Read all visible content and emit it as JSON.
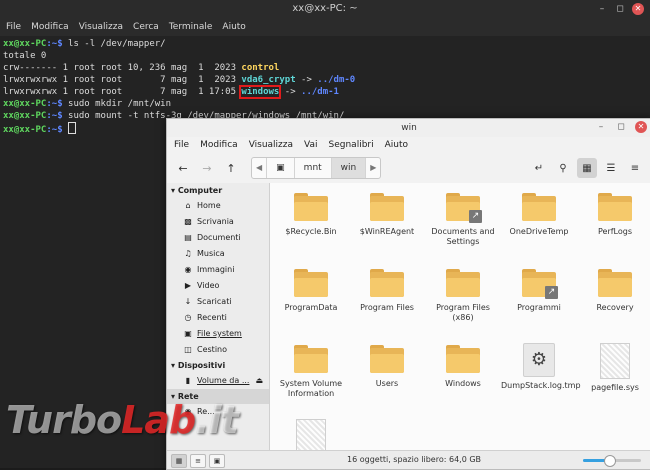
{
  "terminal": {
    "title": "xx@xx-PC: ~",
    "menu": [
      "File",
      "Modifica",
      "Visualizza",
      "Cerca",
      "Terminale",
      "Aiuto"
    ],
    "prompt_user": "xx@xx-PC",
    "prompt_path": ":~$",
    "cmd1": " ls -l /dev/mapper/",
    "out_total": "totale 0",
    "row1_perm": "crw------- 1 root root 10, 236 mag  1  2023 ",
    "row1_name": "control",
    "row2_perm": "lrwxrwxrwx 1 root root       7 mag  1  2023 ",
    "row2_name": "vda6_crypt",
    "row2_arrow": " -> ",
    "row2_target": "../dm-0",
    "row3_perm": "lrwxrwxrwx 1 root root       7 mag  1 17:05 ",
    "row3_name": "windows",
    "row3_arrow": " -> ",
    "row3_target": "../dm-1",
    "cmd2": " sudo mkdir /mnt/win",
    "cmd3": " sudo mount -t ntfs-3g /dev/mapper/windows /mnt/win/"
  },
  "filemanager": {
    "title": "win",
    "menu": [
      "File",
      "Modifica",
      "Visualizza",
      "Vai",
      "Segnalibri",
      "Aiuto"
    ],
    "breadcrumbs": [
      "mnt",
      "win"
    ],
    "sidebar": {
      "computer_label": "Computer",
      "computer_items": [
        {
          "label": "Home",
          "icon": "home-icon"
        },
        {
          "label": "Scrivania",
          "icon": "desktop-icon"
        },
        {
          "label": "Documenti",
          "icon": "documents-icon"
        },
        {
          "label": "Musica",
          "icon": "music-icon"
        },
        {
          "label": "Immagini",
          "icon": "pictures-icon"
        },
        {
          "label": "Video",
          "icon": "video-icon"
        },
        {
          "label": "Scaricati",
          "icon": "downloads-icon"
        },
        {
          "label": "Recenti",
          "icon": "recent-icon"
        },
        {
          "label": "File system",
          "icon": "filesystem-icon"
        },
        {
          "label": "Cestino",
          "icon": "trash-icon"
        }
      ],
      "devices_label": "Dispositivi",
      "devices_items": [
        {
          "label": "Volume da ...",
          "icon": "drive-icon"
        }
      ],
      "network_label": "Rete",
      "network_items": [
        {
          "label": "Re...",
          "icon": "network-icon"
        }
      ]
    },
    "files": [
      {
        "name": "$Recycle.Bin",
        "kind": "folder"
      },
      {
        "name": "$WinREAgent",
        "kind": "folder"
      },
      {
        "name": "Documents and Settings",
        "kind": "folder-link"
      },
      {
        "name": "OneDriveTemp",
        "kind": "folder"
      },
      {
        "name": "PerfLogs",
        "kind": "folder"
      },
      {
        "name": "ProgramData",
        "kind": "folder"
      },
      {
        "name": "Program Files",
        "kind": "folder"
      },
      {
        "name": "Program Files (x86)",
        "kind": "folder"
      },
      {
        "name": "Programmi",
        "kind": "folder-link"
      },
      {
        "name": "Recovery",
        "kind": "folder"
      },
      {
        "name": "System Volume Information",
        "kind": "folder"
      },
      {
        "name": "Users",
        "kind": "folder"
      },
      {
        "name": "Windows",
        "kind": "folder"
      },
      {
        "name": "DumpStack.log.tmp",
        "kind": "gear"
      },
      {
        "name": "pagefile.sys",
        "kind": "sys"
      },
      {
        "name": "",
        "kind": "sys"
      }
    ],
    "status": "16 oggetti, spazio libero: 64,0 GB",
    "zoom_fraction": 0.45
  },
  "watermark": {
    "part1": "Turbo",
    "part2": "Lab",
    "part3": ".it"
  },
  "colors": {
    "terminal_bg": "#232323",
    "folder": "#f5c96b",
    "highlight": "#e01b1b",
    "accent": "#35a0e0"
  }
}
